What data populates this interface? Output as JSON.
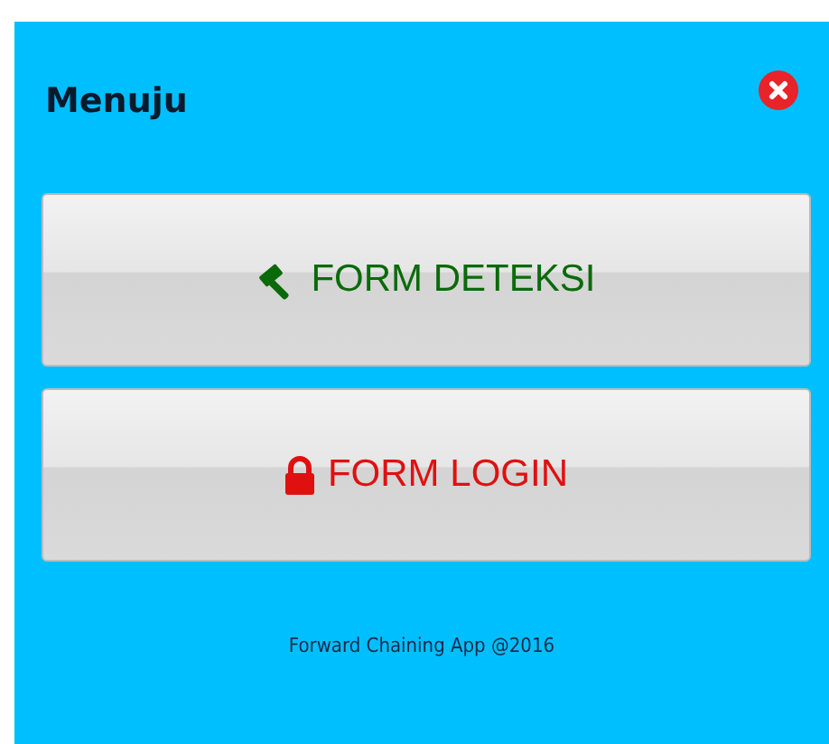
{
  "dialog": {
    "title": "Menuju"
  },
  "buttons": [
    {
      "label": "FORM DETEKSI",
      "kind": "gavel",
      "color": "#0a6a0a"
    },
    {
      "label": "FORM LOGIN",
      "kind": "lock",
      "color": "#e01010"
    }
  ],
  "footer": "Forward Chaining App @2016"
}
